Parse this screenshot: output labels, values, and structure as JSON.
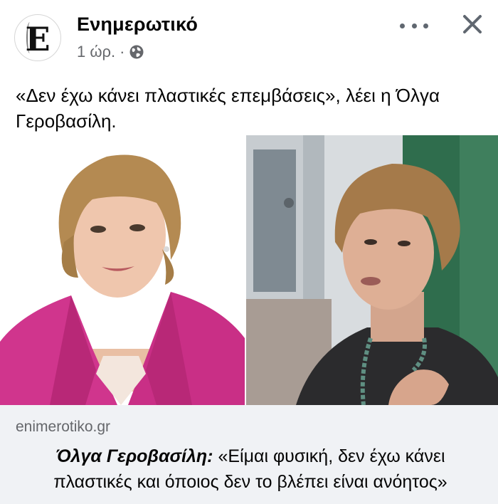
{
  "post": {
    "page_name": "Ενημερωτικό",
    "avatar_letter": "E",
    "time": "1 ώρ.",
    "separator": "·",
    "caption": "«Δεν έχω κάνει πλαστικές επεμβάσεις», λέει η Όλγα Γεροβασίλη."
  },
  "icons": {
    "visibility": "globe-icon",
    "menu": "more-horizontal-icon",
    "close": "close-icon"
  },
  "link_preview": {
    "domain": "enimerotiko.gr",
    "title_name": "Όλγα Γεροβασίλη:",
    "title_quote": "«Είμαι φυσική, δεν έχω κάνει πλαστικές και όποιος δεν το βλέπει είναι ανόητος»"
  },
  "colors": {
    "text": "#050505",
    "secondary_text": "#65676b",
    "preview_background": "#f0f2f5",
    "blazer": "#d0358d"
  }
}
